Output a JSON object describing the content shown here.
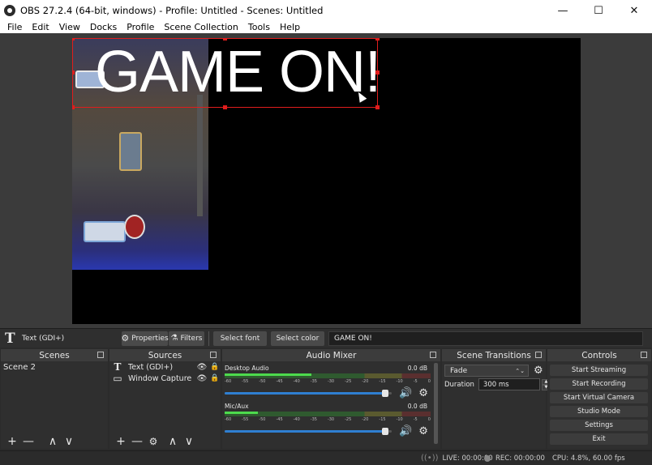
{
  "window": {
    "title": "OBS 27.2.4 (64-bit, windows) - Profile: Untitled - Scenes: Untitled",
    "minimize_glyph": "—",
    "maximize_glyph": "☐",
    "close_glyph": "✕"
  },
  "menu": [
    "File",
    "Edit",
    "View",
    "Docks",
    "Profile",
    "Scene Collection",
    "Tools",
    "Help"
  ],
  "preview": {
    "text_overlay": "GAME ON!",
    "selection_color": "#e01d1d",
    "background": "#000000"
  },
  "context_bar": {
    "source_icon": "T",
    "source_name": "Text (GDI+)",
    "properties_label": "Properties",
    "filters_label": "Filters",
    "select_font_label": "Select font",
    "select_color_label": "Select color",
    "text_value": "GAME ON!"
  },
  "scenes": {
    "title": "Scenes",
    "items": [
      "Scene 2"
    ],
    "footer": [
      "+",
      "—",
      "∧",
      "∨"
    ]
  },
  "sources": {
    "title": "Sources",
    "items": [
      {
        "icon": "T",
        "label": "Text (GDI+)"
      },
      {
        "icon": "▭",
        "label": "Window Capture"
      }
    ],
    "footer": [
      "+",
      "—",
      "⚙",
      "∧",
      "∨"
    ]
  },
  "audio_mixer": {
    "title": "Audio Mixer",
    "channels": [
      {
        "name": "Desktop Audio",
        "level": "0.0 dB",
        "volume": 0.98,
        "meter": 0.42
      },
      {
        "name": "Mic/Aux",
        "level": "0.0 dB",
        "volume": 0.98,
        "meter": 0.16
      }
    ],
    "scale": [
      "-60",
      "-55",
      "-50",
      "-45",
      "-40",
      "-35",
      "-30",
      "-25",
      "-20",
      "-15",
      "-10",
      "-5",
      "0"
    ]
  },
  "transitions": {
    "title": "Scene Transitions",
    "selected": "Fade",
    "duration_label": "Duration",
    "duration_value": "300 ms"
  },
  "controls": {
    "title": "Controls",
    "buttons": [
      "Start Streaming",
      "Start Recording",
      "Start Virtual Camera",
      "Studio Mode",
      "Settings",
      "Exit"
    ]
  },
  "status": {
    "live": "LIVE: 00:00:00",
    "rec": "REC: 00:00:00",
    "cpu": "CPU: 4.8%, 60.00 fps"
  },
  "colors": {
    "accent_blue": "#2f7fd1",
    "meter_green": "#4ddb4d",
    "dock_bg": "#2f2f2f"
  }
}
